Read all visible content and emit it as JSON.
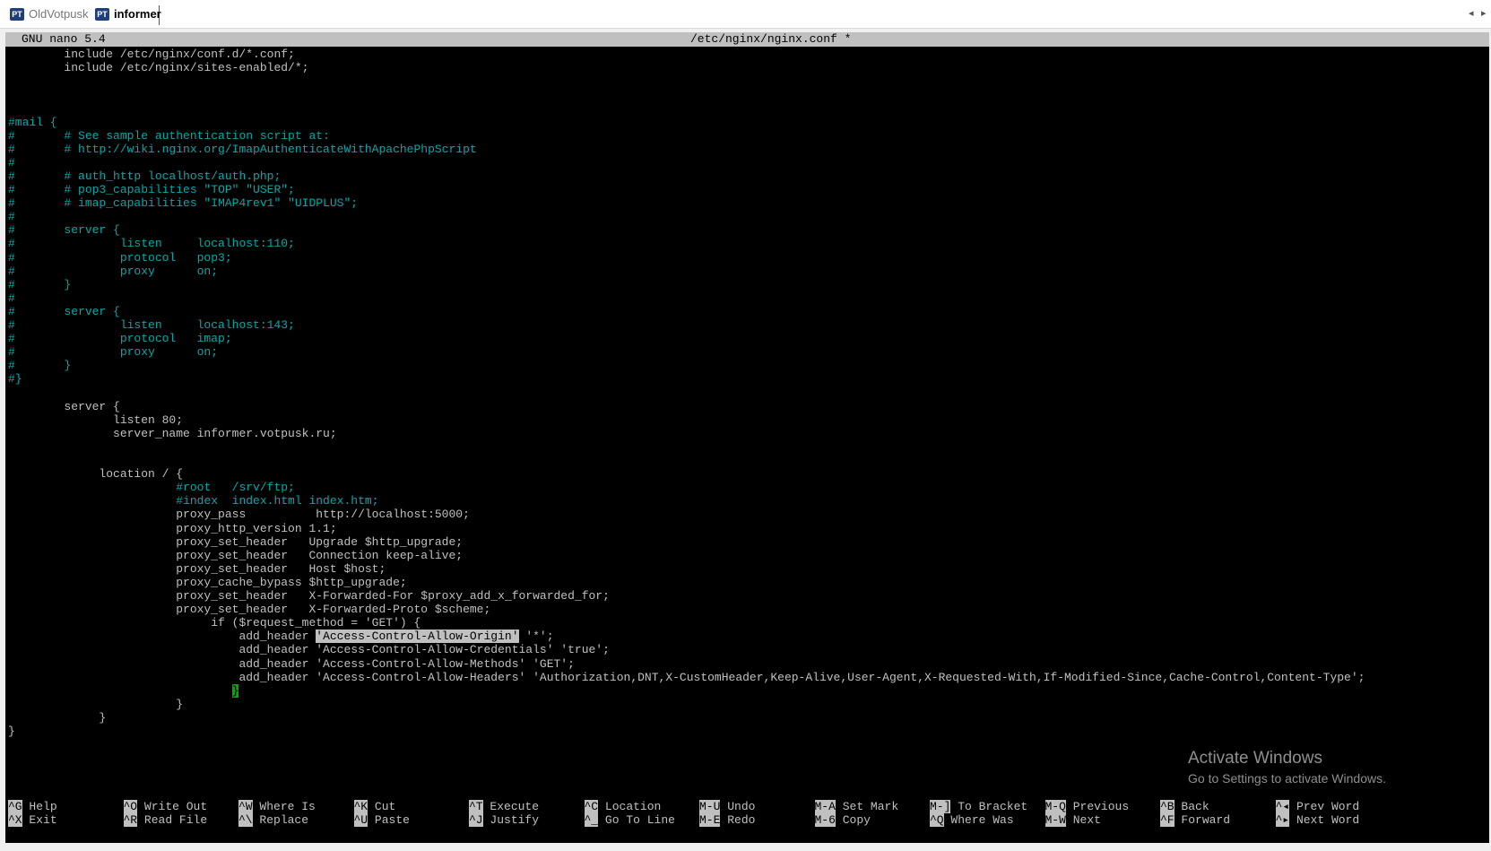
{
  "window": {
    "tabs": [
      {
        "label": "OldVotpusk",
        "icon": "putty-session-icon",
        "active": false
      },
      {
        "label": "informer",
        "icon": "putty-session-icon",
        "active": true
      }
    ],
    "nav_left": "◂",
    "nav_right": "▸"
  },
  "editor": {
    "app": "GNU nano 5.4",
    "file": "/etc/nginx/nginx.conf *",
    "lines": [
      [
        {
          "t": "        include /etc/nginx/conf.d/*.conf;"
        }
      ],
      [
        {
          "t": "        include /etc/nginx/sites-enabled/*;"
        }
      ],
      [],
      [],
      [],
      [
        {
          "t": "#mail {",
          "c": "c"
        }
      ],
      [
        {
          "t": "#       # See sample authentication script at:",
          "c": "c"
        }
      ],
      [
        {
          "t": "#       # http://wiki.nginx.org/ImapAuthenticateWithApachePhpScript",
          "c": "c"
        }
      ],
      [
        {
          "t": "#",
          "c": "c"
        }
      ],
      [
        {
          "t": "#       # auth_http localhost/auth.php;",
          "c": "c"
        }
      ],
      [
        {
          "t": "#       # pop3_capabilities \"TOP\" \"USER\";",
          "c": "c"
        }
      ],
      [
        {
          "t": "#       # imap_capabilities \"IMAP4rev1\" \"UIDPLUS\";",
          "c": "c"
        }
      ],
      [
        {
          "t": "#",
          "c": "c"
        }
      ],
      [
        {
          "t": "#       server {",
          "c": "c"
        }
      ],
      [
        {
          "t": "#               listen     localhost:110;",
          "c": "c"
        }
      ],
      [
        {
          "t": "#               protocol   pop3;",
          "c": "c"
        }
      ],
      [
        {
          "t": "#               proxy      on;",
          "c": "c"
        }
      ],
      [
        {
          "t": "#       }",
          "c": "c"
        }
      ],
      [
        {
          "t": "#",
          "c": "c"
        }
      ],
      [
        {
          "t": "#       server {",
          "c": "c"
        }
      ],
      [
        {
          "t": "#               listen     localhost:143;",
          "c": "c"
        }
      ],
      [
        {
          "t": "#               protocol   imap;",
          "c": "c"
        }
      ],
      [
        {
          "t": "#               proxy      on;",
          "c": "c"
        }
      ],
      [
        {
          "t": "#       }",
          "c": "c"
        }
      ],
      [
        {
          "t": "#}",
          "c": "c"
        }
      ],
      [],
      [
        {
          "t": "        server {"
        }
      ],
      [
        {
          "t": "               listen 80;"
        }
      ],
      [
        {
          "t": "               server_name informer.votpusk.ru;"
        }
      ],
      [],
      [],
      [
        {
          "t": "             location / {"
        }
      ],
      [
        {
          "t": "                        "
        },
        {
          "t": "#root   /srv/ftp;",
          "c": "c"
        }
      ],
      [
        {
          "t": "                        "
        },
        {
          "t": "#index  index.html index.htm;",
          "c": "c"
        }
      ],
      [
        {
          "t": "                        proxy_pass          http://localhost:5000;"
        }
      ],
      [
        {
          "t": "                        proxy_http_version 1.1;"
        }
      ],
      [
        {
          "t": "                        proxy_set_header   Upgrade $http_upgrade;"
        }
      ],
      [
        {
          "t": "                        proxy_set_header   Connection keep-alive;"
        }
      ],
      [
        {
          "t": "                        proxy_set_header   Host $host;"
        }
      ],
      [
        {
          "t": "                        proxy_cache_bypass $http_upgrade;"
        }
      ],
      [
        {
          "t": "                        proxy_set_header   X-Forwarded-For $proxy_add_x_forwarded_for;"
        }
      ],
      [
        {
          "t": "                        proxy_set_header   X-Forwarded-Proto $scheme;"
        }
      ],
      [
        {
          "t": "                             if ($request_method = 'GET') {"
        }
      ],
      [
        {
          "t": "                                 add_header "
        },
        {
          "t": "'Access-Control-Allow-Origin'",
          "c": "h"
        },
        {
          "t": " '*';"
        }
      ],
      [
        {
          "t": "                                 add_header 'Access-Control-Allow-Credentials' 'true';"
        }
      ],
      [
        {
          "t": "                                 add_header 'Access-Control-Allow-Methods' 'GET';"
        }
      ],
      [
        {
          "t": "                                 add_header 'Access-Control-Allow-Headers' 'Authorization,DNT,X-CustomHeader,Keep-Alive,User-Agent,X-Requested-With,If-Modified-Since,Cache-Control,Content-Type';"
        }
      ],
      [
        {
          "t": "                                "
        },
        {
          "t": "}",
          "c": "k"
        }
      ],
      [
        {
          "t": "                        }"
        }
      ],
      [
        {
          "t": "             }"
        }
      ],
      [
        {
          "t": "}"
        }
      ]
    ]
  },
  "shortcuts": [
    [
      {
        "key": "^G",
        "label": "Help"
      },
      {
        "key": "^X",
        "label": "Exit"
      }
    ],
    [
      {
        "key": "^O",
        "label": "Write Out"
      },
      {
        "key": "^R",
        "label": "Read File"
      }
    ],
    [
      {
        "key": "^W",
        "label": "Where Is"
      },
      {
        "key": "^\\",
        "label": "Replace"
      }
    ],
    [
      {
        "key": "^K",
        "label": "Cut"
      },
      {
        "key": "^U",
        "label": "Paste"
      }
    ],
    [
      {
        "key": "^T",
        "label": "Execute"
      },
      {
        "key": "^J",
        "label": "Justify"
      }
    ],
    [
      {
        "key": "^C",
        "label": "Location"
      },
      {
        "key": "^_",
        "label": "Go To Line"
      }
    ],
    [
      {
        "key": "M-U",
        "label": "Undo"
      },
      {
        "key": "M-E",
        "label": "Redo"
      }
    ],
    [
      {
        "key": "M-A",
        "label": "Set Mark"
      },
      {
        "key": "M-6",
        "label": "Copy"
      }
    ],
    [
      {
        "key": "M-]",
        "label": "To Bracket"
      },
      {
        "key": "^Q",
        "label": "Where Was"
      }
    ],
    [
      {
        "key": "M-Q",
        "label": "Previous"
      },
      {
        "key": "M-W",
        "label": "Next"
      }
    ],
    [
      {
        "key": "^B",
        "label": "Back"
      },
      {
        "key": "^F",
        "label": "Forward"
      }
    ],
    [
      {
        "key": "^◂",
        "label": "Prev Word"
      },
      {
        "key": "^▸",
        "label": "Next Word"
      }
    ]
  ],
  "watermark": {
    "title": "Activate Windows",
    "subtitle": "Go to Settings to activate Windows."
  },
  "colors": {
    "terminal_bg": "#000000",
    "text": "#c0c0c0",
    "comment": "#00aaaa",
    "titlebar": "#c0c0c0",
    "selection": "#c0c0c0",
    "cursor": "#00aa00"
  }
}
